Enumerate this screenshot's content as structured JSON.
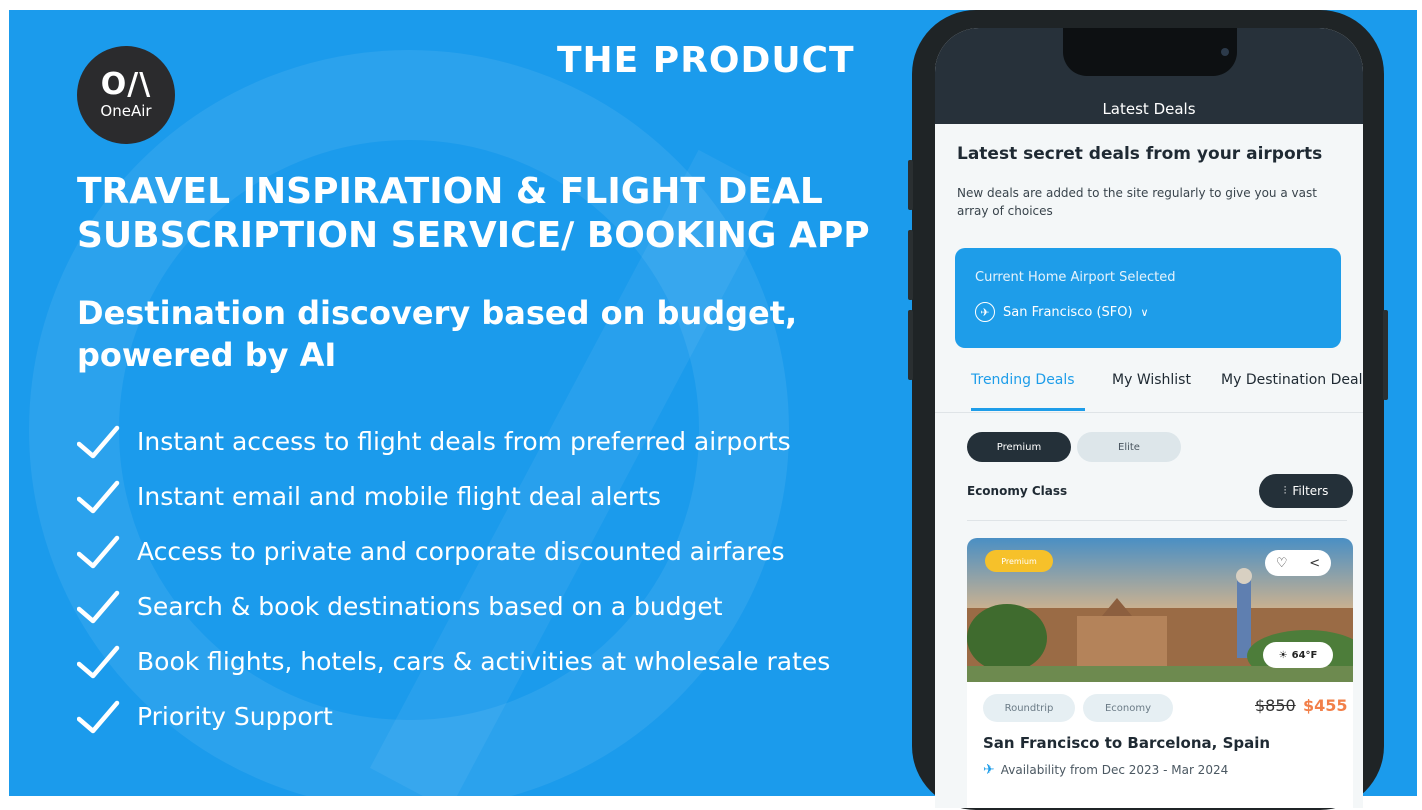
{
  "slide": {
    "logo_mark": "O/\\",
    "logo_text": "OneAir",
    "section_title": "THE PRODUCT",
    "headline": "TRAVEL INSPIRATION & FLIGHT DEAL SUBSCRIPTION SERVICE/ BOOKING APP",
    "subhead": "Destination discovery based on budget, powered by AI",
    "features": [
      "Instant access to flight deals from preferred airports",
      "Instant email and mobile flight deal alerts",
      "Access to private and corporate discounted  airfares",
      "Search & book destinations based on a budget",
      "Book flights, hotels, cars & activities at wholesale rates",
      "Priority Support"
    ],
    "colors": {
      "background": "#1b9bec",
      "logo_bg": "#2b2b2d"
    }
  },
  "app": {
    "screen_title": "Latest Deals",
    "section_title": "Latest secret deals from your airports",
    "section_desc": "New deals are added to the site regularly to give you a vast array of choices",
    "airport": {
      "label": "Current Home Airport Selected",
      "value": "San Francisco (SFO)",
      "icon": "plane-icon"
    },
    "tabs": [
      "Trending Deals",
      "My Wishlist",
      "My Destination Deals"
    ],
    "active_tab": "Trending Deals",
    "pills": [
      "Premium",
      "Elite"
    ],
    "cabin_class": "Economy Class",
    "filters_label": "Filters",
    "deal": {
      "badge": "Premium",
      "weather": "64°F",
      "tags": [
        "Roundtrip",
        "Economy"
      ],
      "old_price": "$850",
      "new_price": "$455",
      "route": "San Francisco to Barcelona, Spain",
      "availability": "Availability from Dec 2023 - Mar 2024"
    },
    "colors": {
      "accent": "#1e9de9",
      "dark": "#243039",
      "price": "#f2804a"
    }
  }
}
